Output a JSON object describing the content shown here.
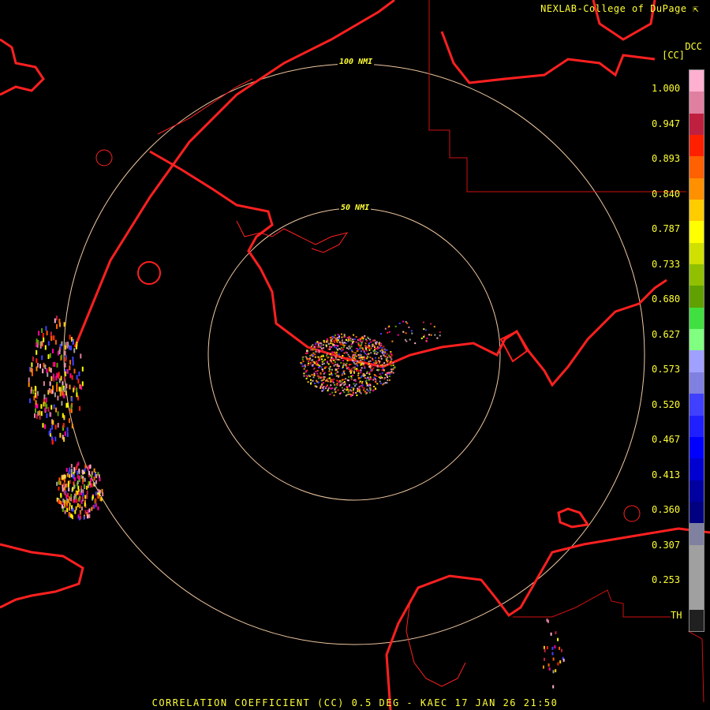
{
  "credit": "NEXLAB-College of DuPage",
  "product_code": "DCC",
  "unit": "[CC]",
  "rings": [
    "50 NMI",
    "100 NMI"
  ],
  "legend_ticks": [
    "1.000",
    "0.947",
    "0.893",
    "0.840",
    "0.787",
    "0.733",
    "0.680",
    "0.627",
    "0.573",
    "0.520",
    "0.467",
    "0.413",
    "0.360",
    "0.307",
    "0.253",
    "TH"
  ],
  "colors": {
    "background": "#000000",
    "boundaries": "#ff2020",
    "text": "#ffff33",
    "range_rings": "#f0c8a0"
  },
  "colorbar": [
    "#ffb0d0",
    "#e080a0",
    "#c02040",
    "#ff2000",
    "#ff6000",
    "#ff9000",
    "#ffcc00",
    "#ffff00",
    "#d0e000",
    "#90c000",
    "#60a000",
    "#40e040",
    "#80ff80",
    "#a0a0ff",
    "#8080e0",
    "#4040ff",
    "#2020ff",
    "#0000ff",
    "#0000d0",
    "#0000a0",
    "#000080",
    "#8080a0",
    "#a0a0a0",
    "#a0a0a0",
    "#a0a0a0",
    "#202020"
  ],
  "footer": "CORRELATION COEFFICIENT (CC) 0.5 DEG - KAEC 17 JAN 26 21:50"
}
